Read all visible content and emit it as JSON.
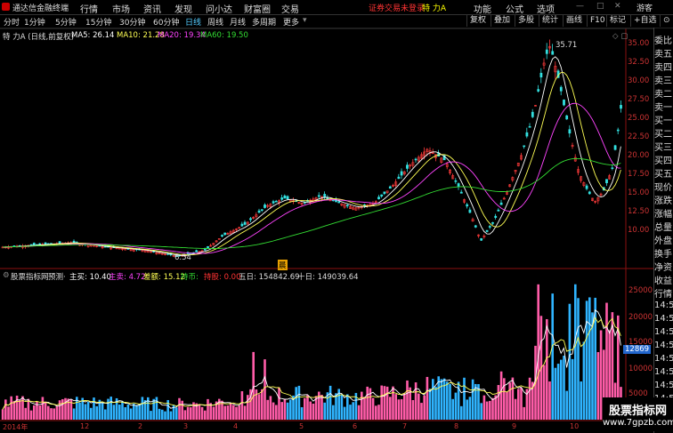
{
  "title_bar": {
    "app_name": "通达信金融终端",
    "menu": [
      "行情",
      "市场",
      "资讯",
      "发现",
      "问小达",
      "财富圈",
      "交易"
    ],
    "notice": "证券交易未登录",
    "stock_badge": "特 力A",
    "right_menu": [
      "功能",
      "公式",
      "选项"
    ],
    "user": "游客"
  },
  "period_bar": {
    "periods": [
      "分时",
      "1分钟",
      "5分钟",
      "15分钟",
      "30分钟",
      "60分钟",
      "日线",
      "周线",
      "月线",
      "多周期",
      "更多"
    ],
    "active": "日线",
    "tools": [
      "复权",
      "叠加",
      "多股",
      "统计",
      "画线",
      "F10",
      "标记",
      "+自选",
      "⊙"
    ]
  },
  "main_chart": {
    "stock_label": "特 力A (日线,前复权)",
    "ma5": "MA5: 26.14",
    "ma10": "MA10: 21.28",
    "ma20": "MA20: 19.34",
    "ma60": "MA60: 19.50",
    "high_mark": "35.71",
    "low_mark": "6.54",
    "event_mark": "晨"
  },
  "sub_chart": {
    "indicator": "股票指标网",
    "predict": "预测·",
    "zhumai": "主买: 10.40",
    "zhumai2": "主卖: 4.72",
    "chaie": "差额: 15.12",
    "chibi": "持币:",
    "chigu": "持股: 0.00",
    "wuri": "五日: 154842.69",
    "shiri": "十日: 149039.64",
    "current_marker": "12869"
  },
  "price_axis": [
    "35.00",
    "32.50",
    "30.00",
    "27.50",
    "25.00",
    "22.50",
    "20.00",
    "17.50",
    "15.00",
    "12.50",
    "10.00"
  ],
  "volume_axis": [
    "25000",
    "20000",
    "15000",
    "10000",
    "5000"
  ],
  "date_axis": [
    "2014年",
    "12",
    "2",
    "3",
    "4",
    "5",
    "6",
    "7",
    "8",
    "9",
    "10"
  ],
  "side_panel": [
    "委比",
    "卖五",
    "卖四",
    "卖三",
    "卖二",
    "卖一",
    "买一",
    "买二",
    "买三",
    "买四",
    "买五",
    "现价",
    "涨跌",
    "涨幅",
    "总量",
    "外盘",
    "换手",
    "净资",
    "收益"
  ],
  "side_panel2": [
    "行情",
    "14:5",
    "14:5",
    "14:5",
    "14:5",
    "14:5",
    "14:5",
    "14:5",
    "14:5",
    "14:5"
  ],
  "watermark": {
    "line1": "股票指标网",
    "line2": "www.7gpzb.com"
  },
  "colors": {
    "up": "#ff3b3b",
    "down": "#33e0e0",
    "ma5": "#ffffff",
    "ma10": "#ffff55",
    "ma20": "#ff44ff",
    "ma60": "#33dd33",
    "vol_up": "#ff5ca8",
    "vol_down": "#2fb4ff"
  }
}
